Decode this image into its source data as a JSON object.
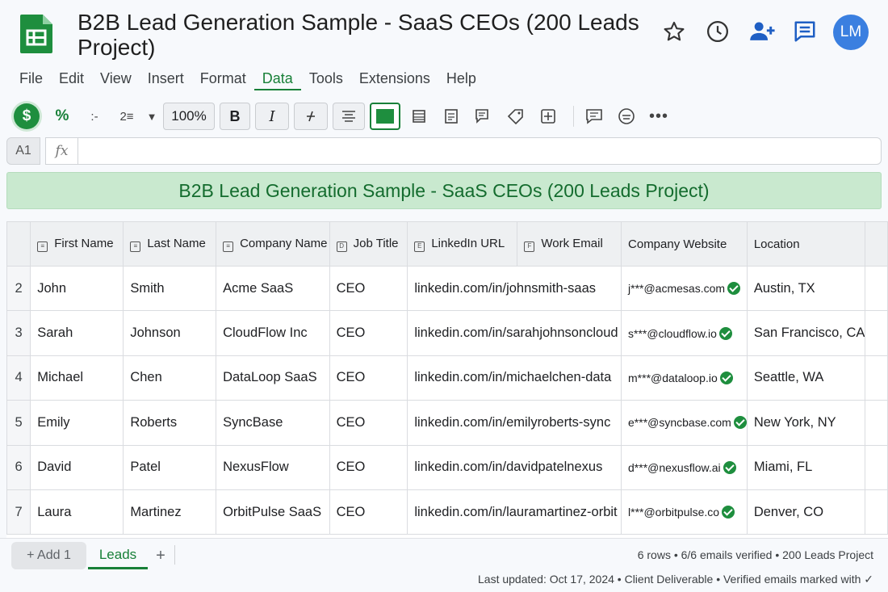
{
  "doc": {
    "title": "B2B Lead Generation Sample - SaaS CEOs (200 Leads Project)",
    "avatar_initials": "LM"
  },
  "header_icons": [
    "star-icon",
    "history-icon",
    "add-person-icon",
    "comment-icon"
  ],
  "menu": [
    "File",
    "Edit",
    "View",
    "Insert",
    "Format",
    "Data",
    "Tools",
    "Extensions",
    "Help"
  ],
  "menu_active": "Data",
  "toolbar": {
    "currency": "$",
    "percent": "%",
    "decrease_decimal": ":-",
    "increase_decimal": "2≡",
    "zoom": "100%",
    "bold": "B",
    "italic": "I",
    "strikethrough": "S"
  },
  "formula_bar": {
    "cell_ref": "A1",
    "fx": "fx",
    "value": ""
  },
  "banner": "B2B Lead Generation Sample - SaaS CEOs (200 Leads Project)",
  "columns": [
    {
      "label": "First Name",
      "icon": "≡"
    },
    {
      "label": "Last Name",
      "icon": "≡"
    },
    {
      "label": "Company Name",
      "icon": "≡"
    },
    {
      "label": "Job Title",
      "icon": "D"
    },
    {
      "label": "LinkedIn URL",
      "icon": "E"
    },
    {
      "label": "Work Email",
      "icon": "F"
    },
    {
      "label": "Company Website",
      "icon": ""
    },
    {
      "label": "Location",
      "icon": ""
    }
  ],
  "rows": [
    {
      "num": "2",
      "first": "John",
      "last": "Smith",
      "company": "Acme SaaS",
      "title": "CEO",
      "linkedin": "linkedin.com/in/johnsmith-saas",
      "email": "j***@acmesas.com",
      "location": "Austin, TX"
    },
    {
      "num": "3",
      "first": "Sarah",
      "last": "Johnson",
      "company": "CloudFlow Inc",
      "title": "CEO",
      "linkedin": "linkedin.com/in/sarahjohnsoncloud",
      "email": "s***@cloudflow.io",
      "location": "San Francisco, CA"
    },
    {
      "num": "4",
      "first": "Michael",
      "last": "Chen",
      "company": "DataLoop SaaS",
      "title": "CEO",
      "linkedin": "linkedin.com/in/michaelchen-data",
      "email": "m***@dataloop.io",
      "location": "Seattle, WA"
    },
    {
      "num": "5",
      "first": "Emily",
      "last": "Roberts",
      "company": "SyncBase",
      "title": "CEO",
      "linkedin": "linkedin.com/in/emilyroberts-sync",
      "email": "e***@syncbase.com",
      "location": "New York, NY"
    },
    {
      "num": "6",
      "first": "David",
      "last": "Patel",
      "company": "NexusFlow",
      "title": "CEO",
      "linkedin": "linkedin.com/in/davidpatelnexus",
      "email": "d***@nexusflow.ai",
      "location": "Miami, FL"
    },
    {
      "num": "7",
      "first": "Laura",
      "last": "Martinez",
      "company": "OrbitPulse SaaS",
      "title": "CEO",
      "linkedin": "linkedin.com/in/lauramartinez-orbit",
      "email": "l***@orbitpulse.co",
      "location": "Denver, CO"
    }
  ],
  "sheet_tabs": {
    "add_tab": "+ Add 1",
    "active_tab": "Leads",
    "new_sheet": "+"
  },
  "status": {
    "line1": "6 rows • 6/6 emails verified • 200 Leads Project",
    "line2": "Last updated: Oct 17, 2024 • Client Deliverable • Verified emails marked with ✓"
  },
  "colors": {
    "accent": "#188038",
    "banner_bg": "#c9e9cf",
    "avatar_bg": "#3a7fe0",
    "header_icon": "#1f5fc4"
  }
}
